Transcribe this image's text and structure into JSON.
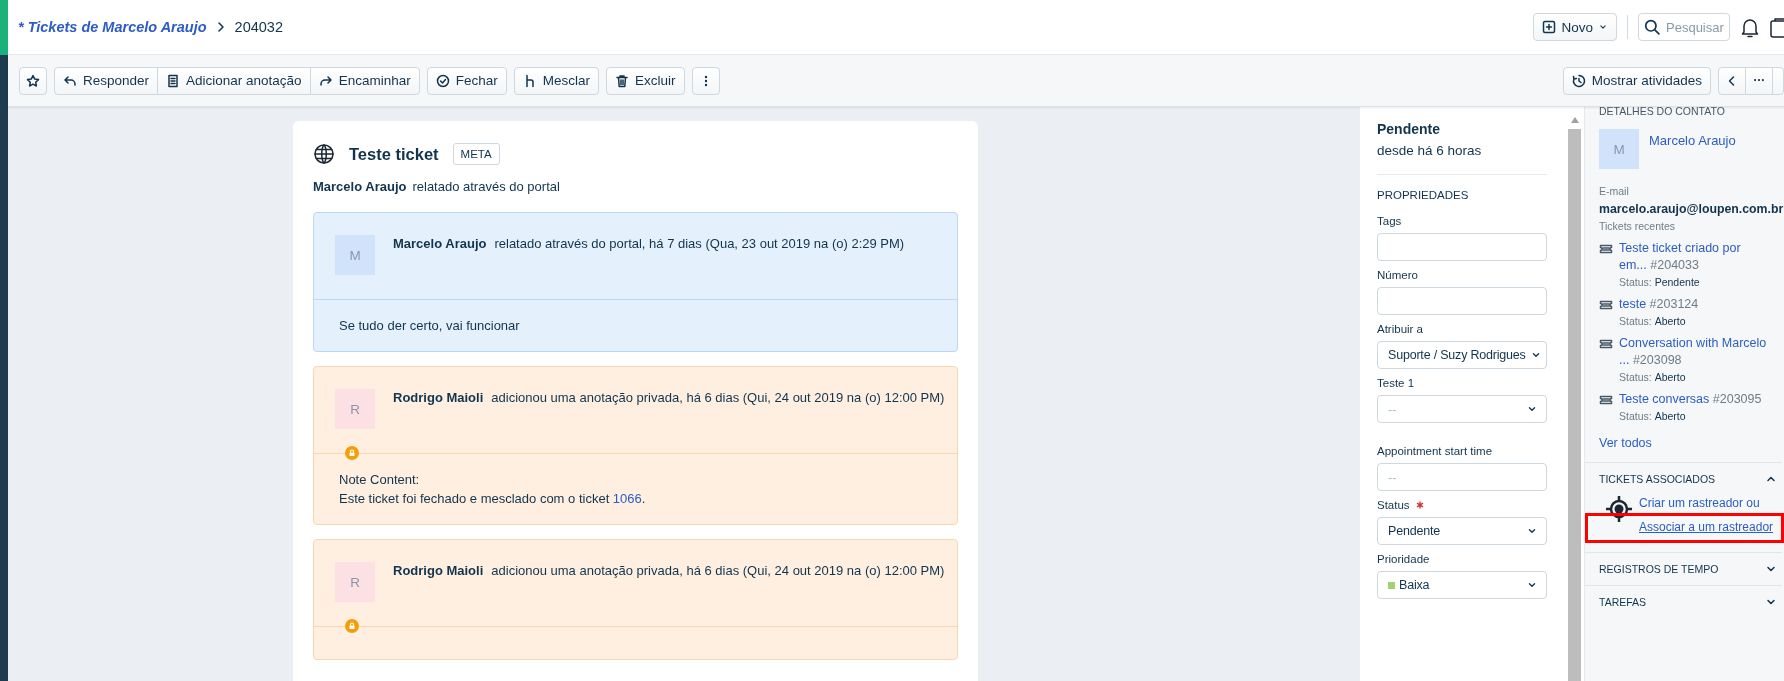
{
  "header": {
    "breadcrumb": "* Tickets de Marcelo Araujo",
    "ticket_id": "204032",
    "new_button": "Novo",
    "search": {
      "placeholder": "Pesquisar"
    }
  },
  "toolbar": {
    "groups": [
      [
        "Responder",
        "Adicionar anotação",
        "Encaminhar"
      ],
      [
        "Fechar"
      ],
      [
        "Mesclar"
      ],
      [
        "Excluir"
      ]
    ],
    "activity_button": "Mostrar atividades"
  },
  "ticket": {
    "title": "Teste ticket",
    "badge": "META",
    "reporter": "Marcelo Araujo",
    "source": "relatado através do portal",
    "conversations": [
      {
        "kind": "reply",
        "initial": "M",
        "author": "Marcelo Araujo",
        "meta": "relatado através do portal, há 7 dias (Qua, 23 out 2019 na (o) 2:29 PM)",
        "body": [
          {
            "text": "Se tudo der certo, vai funcionar"
          }
        ]
      },
      {
        "kind": "private_note",
        "initial": "R",
        "author": "Rodrigo Maioli",
        "meta": "adicionou uma anotação privada, há 6 dias (Qui, 24 out 2019 na (o) 12:00 PM)",
        "body": [
          {
            "text": "Note Content:"
          },
          {
            "text": "Este ticket foi fechado e mesclado com o ticket ",
            "link": "1066",
            "after": "."
          }
        ]
      },
      {
        "kind": "private_note",
        "initial": "R",
        "author": "Rodrigo Maioli",
        "meta": "adicionou uma anotação privada, há 6 dias (Qui, 24 out 2019 na (o) 12:00 PM)"
      }
    ]
  },
  "properties": {
    "status": "Pendente",
    "since": "desde há 6 horas",
    "heading": "PROPRIEDADES",
    "fields": [
      {
        "kind": "input",
        "label": "Tags",
        "required": false
      },
      {
        "kind": "input",
        "label": "Número",
        "required": false
      },
      {
        "kind": "select",
        "label": "Atribuir a",
        "value": "Suporte / Suzy Rodrigues",
        "required": false
      },
      {
        "kind": "select",
        "label": "Teste 1",
        "placeholder": "--",
        "required": false
      },
      {
        "kind": "input",
        "label": "Appointment start time",
        "placeholder": "--",
        "required": false
      },
      {
        "kind": "select",
        "label": "Status",
        "value": "Pendente",
        "required": true
      },
      {
        "kind": "select",
        "label": "Prioridade",
        "value": "Baixa",
        "color": "#9fd36b",
        "required": false
      }
    ]
  },
  "contact": {
    "heading": "DETALHES DO CONTATO",
    "initial": "M",
    "name": "Marcelo Araujo",
    "email_label": "E-mail",
    "email": "marcelo.araujo@loupen.com.br",
    "recent_label": "Tickets recentes",
    "recent_tickets": [
      {
        "title": "Teste ticket criado por em...",
        "number": "#204033",
        "status_label": "Status:",
        "status": "Pendente"
      },
      {
        "title": "teste",
        "number": "#203124",
        "status_label": "Status:",
        "status": "Aberto"
      },
      {
        "title": "Conversation with Marcelo ...",
        "number": "#203098",
        "status_label": "Status:",
        "status": "Aberto"
      },
      {
        "title": "Teste conversas",
        "number": "#203095",
        "status_label": "Status:",
        "status": "Aberto"
      }
    ],
    "view_all": "Ver todos"
  },
  "sections": [
    {
      "title": "TICKETS ASSOCIADOS",
      "expanded": true,
      "text": "Criar um rastreador ou",
      "link": "Associar a um rastreador",
      "highlighted": true
    },
    {
      "title": "REGISTROS DE TEMPO",
      "expanded": false
    },
    {
      "title": "TAREFAS",
      "expanded": false
    }
  ]
}
